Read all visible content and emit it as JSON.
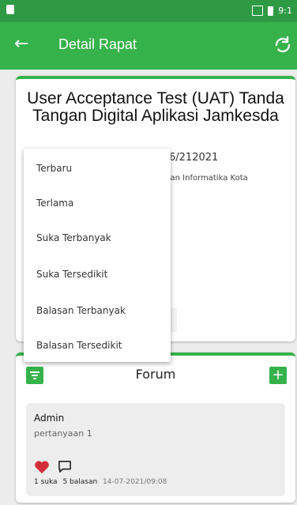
{
  "statusbar": {
    "time": "9:1"
  },
  "appbar": {
    "back_icon": "arrow-left-icon",
    "title": "Detail Rapat",
    "refresh_icon": "refresh-icon"
  },
  "meeting": {
    "title": "User Acceptance Test (UAT) Tanda Tangan Digital Aplikasi Jamkesda",
    "date_fragment": "6/212021",
    "org_fragment": "si dan Informatika Kota"
  },
  "sort_menu": {
    "options": [
      "Terbaru",
      "Terlama",
      "Suka Terbanyak",
      "Suka Tersedikit",
      "Balasan Terbanyak",
      "Balasan Tersedikit"
    ]
  },
  "forum": {
    "title": "Forum",
    "filter_icon": "filter-icon",
    "add_label": "+",
    "comments": [
      {
        "author": "Admin",
        "text": "pertanyaan 1",
        "likes": "1 suka",
        "replies": "5 balasan",
        "time": "14-07-2021/09:08"
      }
    ]
  },
  "colors": {
    "primary": "#36b24a",
    "statusbar": "#2e9a44",
    "like": "#d32f3a"
  }
}
